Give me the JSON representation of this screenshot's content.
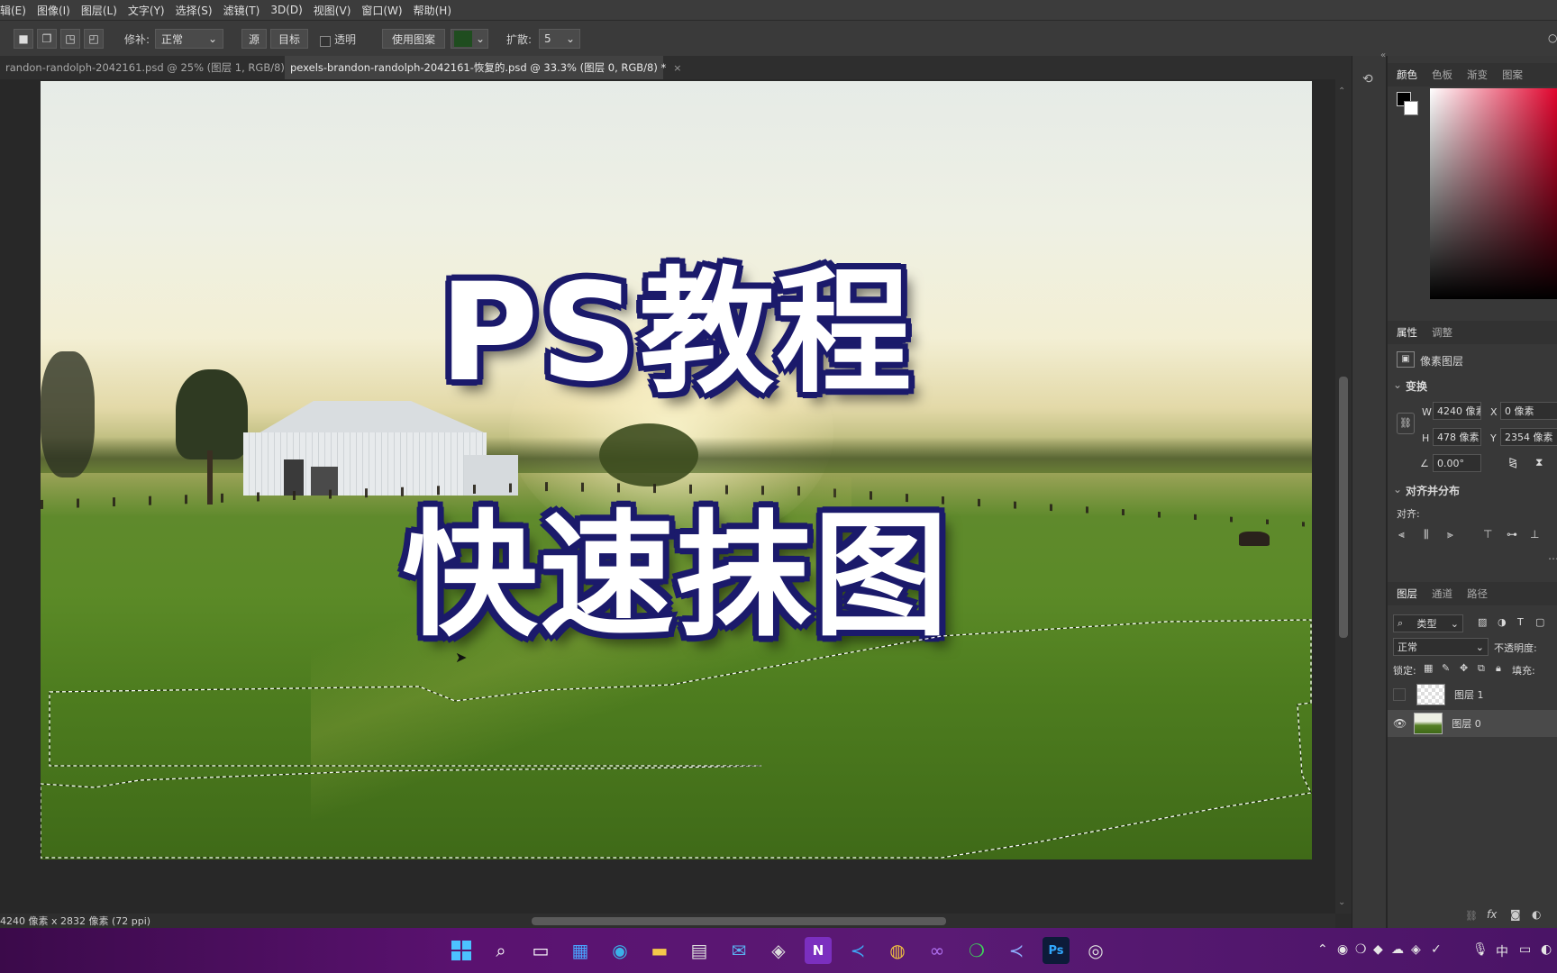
{
  "menu": [
    "辑(E)",
    "图像(I)",
    "图层(L)",
    "文字(Y)",
    "选择(S)",
    "滤镜(T)",
    "3D(D)",
    "视图(V)",
    "窗口(W)",
    "帮助(H)"
  ],
  "options": {
    "patch_label": "修补:",
    "patch_mode": "正常",
    "source_btn": "源",
    "target_btn": "目标",
    "transparent_label": "透明",
    "use_pattern_btn": "使用图案",
    "diffusion_label": "扩散:",
    "diffusion_value": "5"
  },
  "tabs": [
    {
      "title": "randon-randolph-2042161.psd @ 25% (图层 1, RGB/8)",
      "active": false
    },
    {
      "title": "pexels-brandon-randolph-2042161-恢复的.psd @ 33.3% (图层 0, RGB/8) *",
      "active": true
    }
  ],
  "canvas": {
    "headline_1": "PS教程",
    "headline_2": "快速抹图"
  },
  "status": {
    "doc_size": "4240 像素 x 2832 像素 (72 ppi)"
  },
  "color_panel": {
    "tabs": [
      "颜色",
      "色板",
      "渐变",
      "图案"
    ]
  },
  "properties_panel": {
    "tabs": [
      "属性",
      "调整"
    ],
    "layer_type": "像素图层",
    "transform_title": "变换",
    "w_label": "W",
    "w_value": "4240 像素",
    "h_label": "H",
    "h_value": "478 像素",
    "x_label": "X",
    "x_value": "0 像素",
    "y_label": "Y",
    "y_value": "2354 像素",
    "angle_value": "0.00°",
    "align_title": "对齐并分布",
    "align_label": "对齐:"
  },
  "layers_panel": {
    "tabs": [
      "图层",
      "通道",
      "路径"
    ],
    "filter_type": "类型",
    "blend_mode": "正常",
    "opacity_label": "不透明度:",
    "lock_label": "锁定:",
    "fill_label": "填充:",
    "layers": [
      {
        "name": "图层 1",
        "visible": false
      },
      {
        "name": "图层 0",
        "visible": true
      }
    ]
  },
  "taskbar": {
    "ime": "中"
  }
}
